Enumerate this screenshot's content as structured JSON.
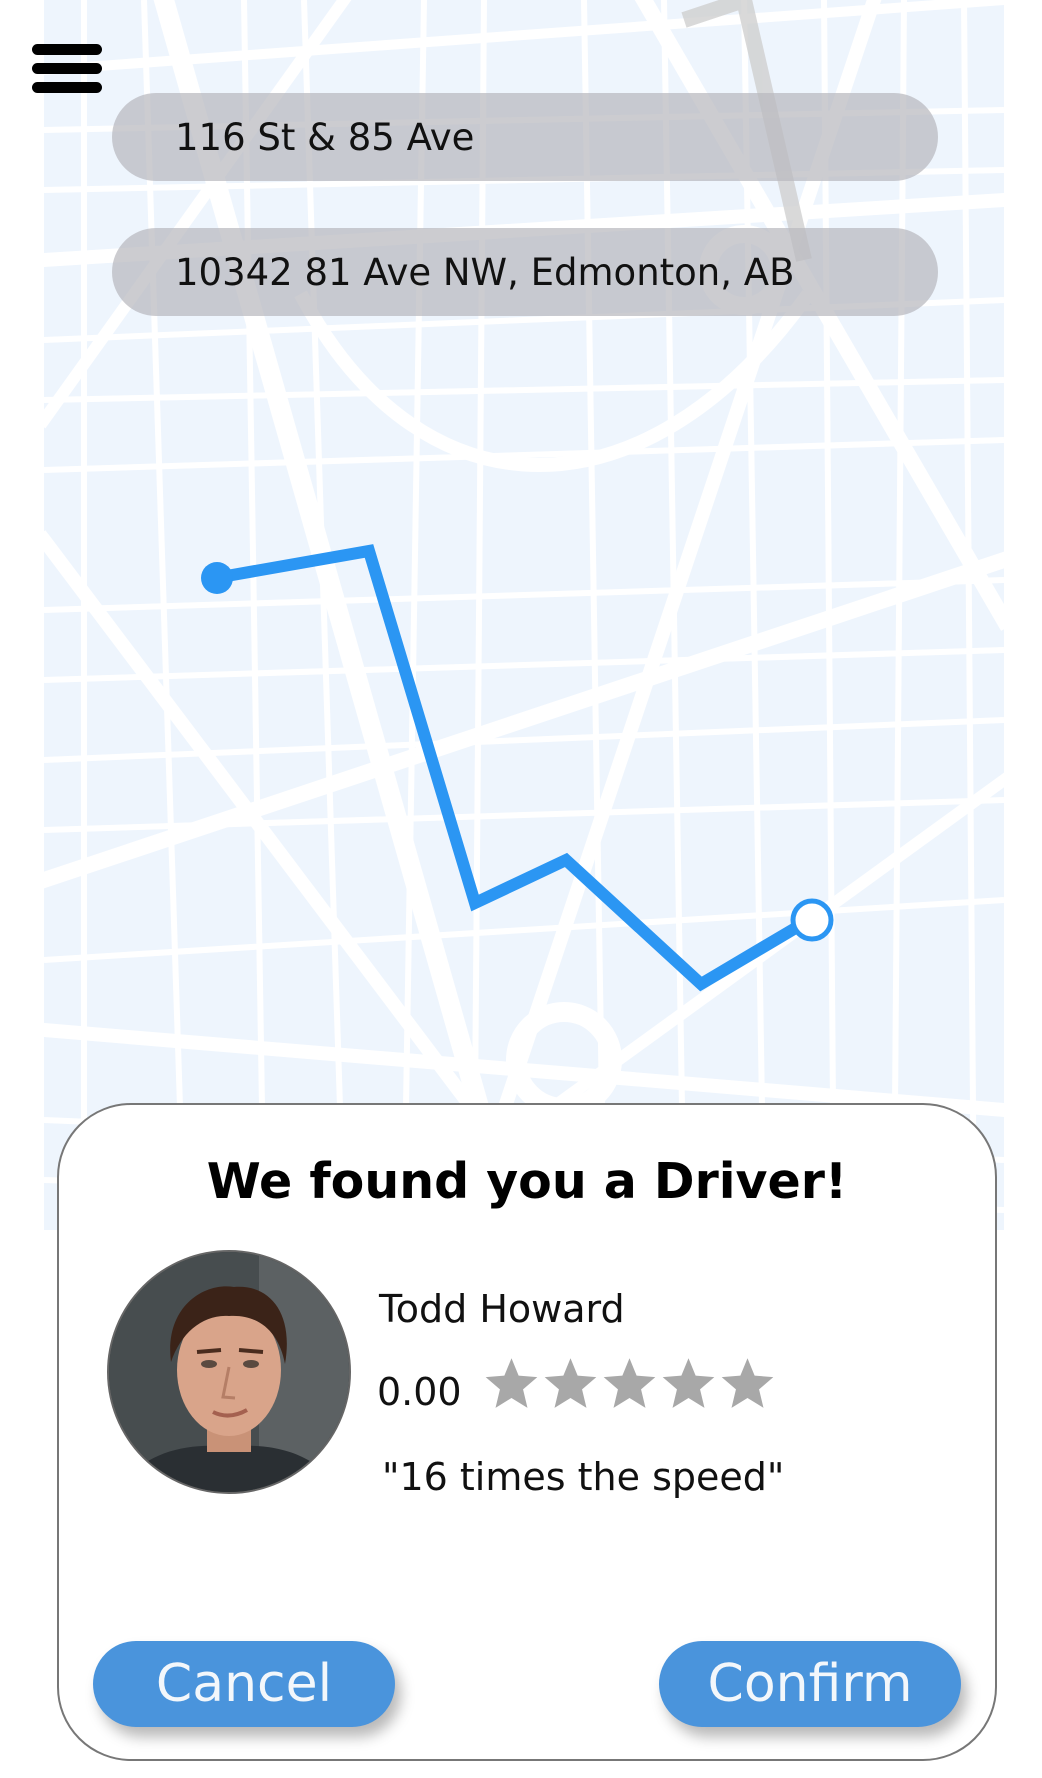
{
  "colors": {
    "route": "#2b96f3",
    "map_background": "#eef5fd",
    "map_roads": "#ffffff",
    "address_field_background": "#b9b9be",
    "button_background": "#4a94dc",
    "button_text": "#f3f7fb",
    "star": "#a8a8a8"
  },
  "header": {
    "menu_icon": "hamburger-menu-icon"
  },
  "route": {
    "pickup": {
      "value": "116 St & 85 Ave",
      "icon": "pickup-dot-icon"
    },
    "destination": {
      "value": "10342 81 Ave NW, Edmonton, AB",
      "icon": "destination-ring-icon"
    }
  },
  "driver_card": {
    "title": "We found you a Driver!",
    "driver": {
      "name": "Todd Howard",
      "rating": "0.00",
      "stars_filled": 0,
      "stars_total": 5,
      "quote": "\"16 times the speed\""
    },
    "buttons": {
      "cancel": "Cancel",
      "confirm": "Confirm"
    }
  }
}
